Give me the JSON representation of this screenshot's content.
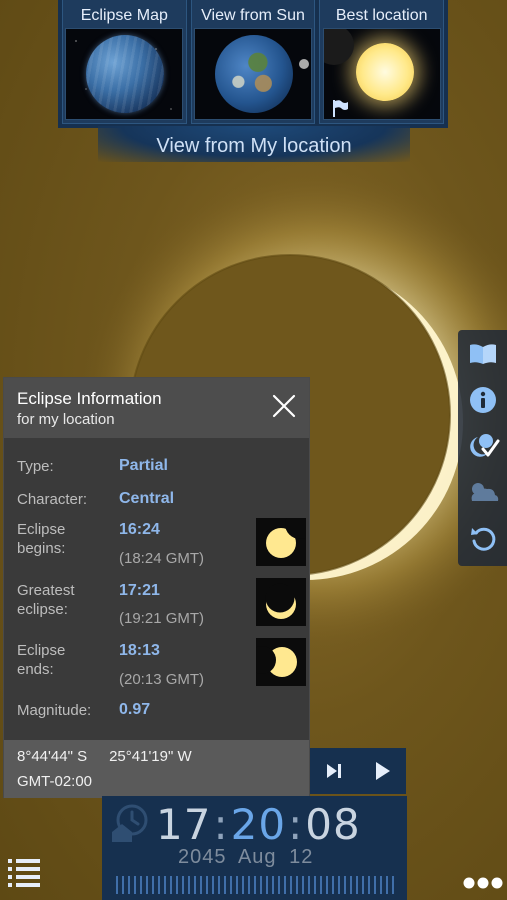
{
  "top_tabs": [
    {
      "label": "Eclipse Map"
    },
    {
      "label": "View from Sun"
    },
    {
      "label": "Best location"
    }
  ],
  "view_banner": {
    "label": "View from My location"
  },
  "info_panel": {
    "title": "Eclipse Information",
    "subtitle": "for my location",
    "rows": {
      "type": {
        "label": "Type:",
        "value": "Partial"
      },
      "character": {
        "label": "Character:",
        "value": "Central"
      },
      "begins": {
        "label_line1": "Eclipse",
        "label_line2": "begins:",
        "value": "16:24",
        "gmt": "(18:24 GMT)"
      },
      "greatest": {
        "label_line1": "Greatest",
        "label_line2": "eclipse:",
        "value": "17:21",
        "gmt": "(19:21 GMT)"
      },
      "ends": {
        "label_line1": "Eclipse",
        "label_line2": "ends:",
        "value": "18:13",
        "gmt": "(20:13 GMT)"
      },
      "magnitude": {
        "label": "Magnitude:",
        "value": "0.97"
      }
    },
    "footer": {
      "latitude": "8°44'44\" S",
      "longitude": "25°41'19\" W",
      "timezone": "GMT-02:00"
    }
  },
  "clock": {
    "hours": "17",
    "minutes": "20",
    "seconds": "08",
    "separator": ":",
    "date": "2045 Aug 12"
  },
  "toolbar_icons": [
    "book-icon",
    "info-icon",
    "moon-sun-check-icon",
    "cloud-sun-icon",
    "reset-icon"
  ],
  "colors": {
    "sky": "#6e561c",
    "panel_dark": "#3a3a3a",
    "accent_blue": "#8fb7ea",
    "nav_blue": "#16304f"
  }
}
